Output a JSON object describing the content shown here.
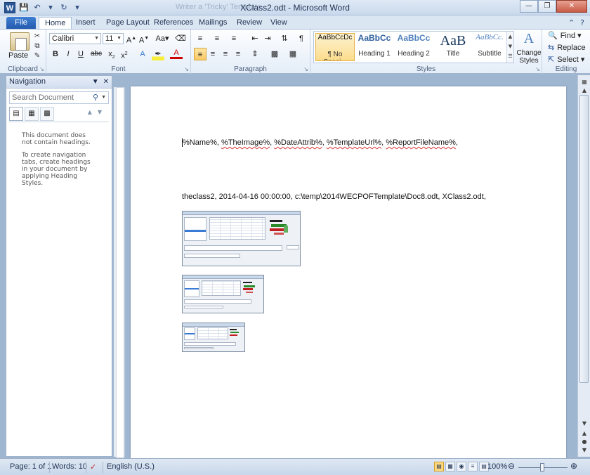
{
  "window": {
    "title": "XClass2.odt - Microsoft Word",
    "ghost_title": "Writer a 'Tricky' Template..."
  },
  "tabs": [
    "File",
    "Home",
    "Insert",
    "Page Layout",
    "References",
    "Mailings",
    "Review",
    "View"
  ],
  "ribbon": {
    "clipboard": {
      "paste": "Paste",
      "label": "Clipboard"
    },
    "font": {
      "name": "Calibri",
      "size": "11",
      "label": "Font"
    },
    "paragraph": {
      "label": "Paragraph"
    },
    "styles": {
      "label": "Styles",
      "items": [
        {
          "sample": "AaBbCcDc",
          "name": "¶ No Spaci..."
        },
        {
          "sample": "AaBbCc",
          "name": "Heading 1"
        },
        {
          "sample": "AaBbCc",
          "name": "Heading 2"
        },
        {
          "sample": "AaB",
          "name": "Title"
        },
        {
          "sample": "AaBbCc.",
          "name": "Subtitle"
        }
      ],
      "change_styles": "Change Styles"
    },
    "editing": {
      "find": "Find",
      "replace": "Replace",
      "select": "Select",
      "label": "Editing"
    }
  },
  "navigation": {
    "title": "Navigation",
    "search_placeholder": "Search Document",
    "message_line1": "This document does not contain headings.",
    "message_line2": "To create navigation tabs, create headings in your document by applying Heading Styles."
  },
  "document": {
    "line1_tokens": [
      "%Name%",
      ", ",
      "%TheImage%",
      ", ",
      "%DateAttrib%",
      ", ",
      "%TemplateUrl%",
      ", ",
      "%ReportFileName%",
      ","
    ],
    "line2": "theclass2, 2014-04-16  00:00:00,  c:\\temp\\2014WECPOFTemplate\\Doc8.odt, XClass2.odt,"
  },
  "status": {
    "page": "Page: 1 of 1",
    "words": "Words: 10",
    "language": "English (U.S.)",
    "zoom": "100%"
  },
  "colors": {
    "file_tab": "#2b5797",
    "close_button": "#c85a45",
    "spell_underline": "#d83838",
    "selected_style": "#fbdc8c"
  }
}
